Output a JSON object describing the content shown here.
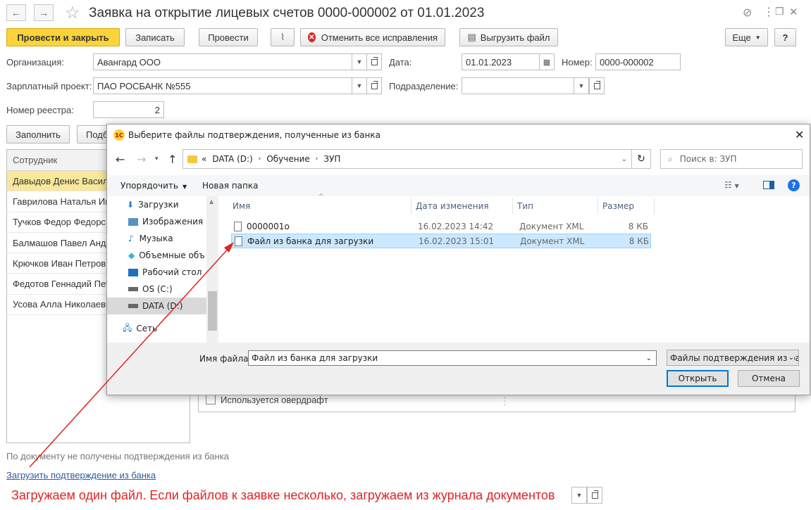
{
  "window": {
    "title": "Заявка на открытие лицевых счетов 0000-000002 от 01.01.2023",
    "nav_back": "←",
    "nav_forward": "→",
    "star": "☆",
    "link_icon": "⊘",
    "menu_icon": "⋮",
    "restore_icon": "❐",
    "close_icon": "✕"
  },
  "toolbar": {
    "post_close": "Провести и закрыть",
    "save": "Записать",
    "post": "Провести",
    "clip": "📎",
    "cancel_fixes": "Отменить все исправления",
    "export_file": "Выгрузить файл",
    "more": "Еще",
    "help": "?"
  },
  "form": {
    "org_label": "Организация:",
    "org_value": "Авангард ООО",
    "date_label": "Дата:",
    "date_value": "01.01.2023",
    "number_label": "Номер:",
    "number_value": "0000-000002",
    "salary_label": "Зарплатный проект:",
    "salary_value": "ПАО РОСБАНК №555",
    "dept_label": "Подразделение:",
    "dept_value": "",
    "registry_label": "Номер реестра:",
    "registry_value": "2",
    "fill_button": "Заполнить",
    "partial_button": "Подб"
  },
  "employees": {
    "header": "Сотрудник",
    "rows": [
      "Давыдов Денис Васил",
      "Гаврилова Наталья Ив",
      "Тучков Федор Федорс",
      "Балмашов Павел Анд",
      "Крючков Иван Петров",
      "Федотов Геннадий Пет",
      "Усова Алла Николаевн"
    ]
  },
  "overdraft_label": "Используется овердрафт",
  "status_text": "По документу не получены подтверждения из банка",
  "load_link": "Загрузить подтверждение из банка",
  "dialog": {
    "title": "Выберите файлы подтверждения, полученные из банка",
    "close": "✕",
    "logo": "1С",
    "path": [
      "«",
      "DATA (D:)",
      "Обучение",
      "ЗУП"
    ],
    "search_placeholder": "Поиск в: ЗУП",
    "organize": "Упорядочить",
    "new_folder": "Новая папка",
    "nav_items": [
      {
        "label": "Загрузки",
        "icon": "downloads-icon"
      },
      {
        "label": "Изображения",
        "icon": "pictures-icon"
      },
      {
        "label": "Музыка",
        "icon": "music-icon"
      },
      {
        "label": "Объемные объ",
        "icon": "objects3d-icon"
      },
      {
        "label": "Рабочий стол",
        "icon": "desktop-icon"
      },
      {
        "label": "OS (C:)",
        "icon": "drive-icon"
      },
      {
        "label": "DATA (D:)",
        "icon": "drive-icon"
      }
    ],
    "network": "Сеть",
    "columns": {
      "name": "Имя",
      "date": "Дата изменения",
      "type": "Тип",
      "size": "Размер"
    },
    "files": [
      {
        "name": "0000001o",
        "date": "16.02.2023 14:42",
        "type": "Документ XML",
        "size": "8 КБ"
      },
      {
        "name": "Файл из банка для загрузки",
        "date": "16.02.2023 15:01",
        "type": "Документ XML",
        "size": "8 КБ"
      }
    ],
    "filename_label": "Имя файла:",
    "filename_value": "Файл из банка для загрузки",
    "filter_value": "Файлы подтверждения из бан",
    "open": "Открыть",
    "cancel": "Отмена"
  },
  "annotation": "Загружаем один файл. Если файлов к заявке несколько, загружаем из журнала документов",
  "colors": {
    "accent_yellow": "#fbd33a",
    "selection": "#f9e79c",
    "annotation_red": "#e02424",
    "win_blue": "#0078d7"
  }
}
